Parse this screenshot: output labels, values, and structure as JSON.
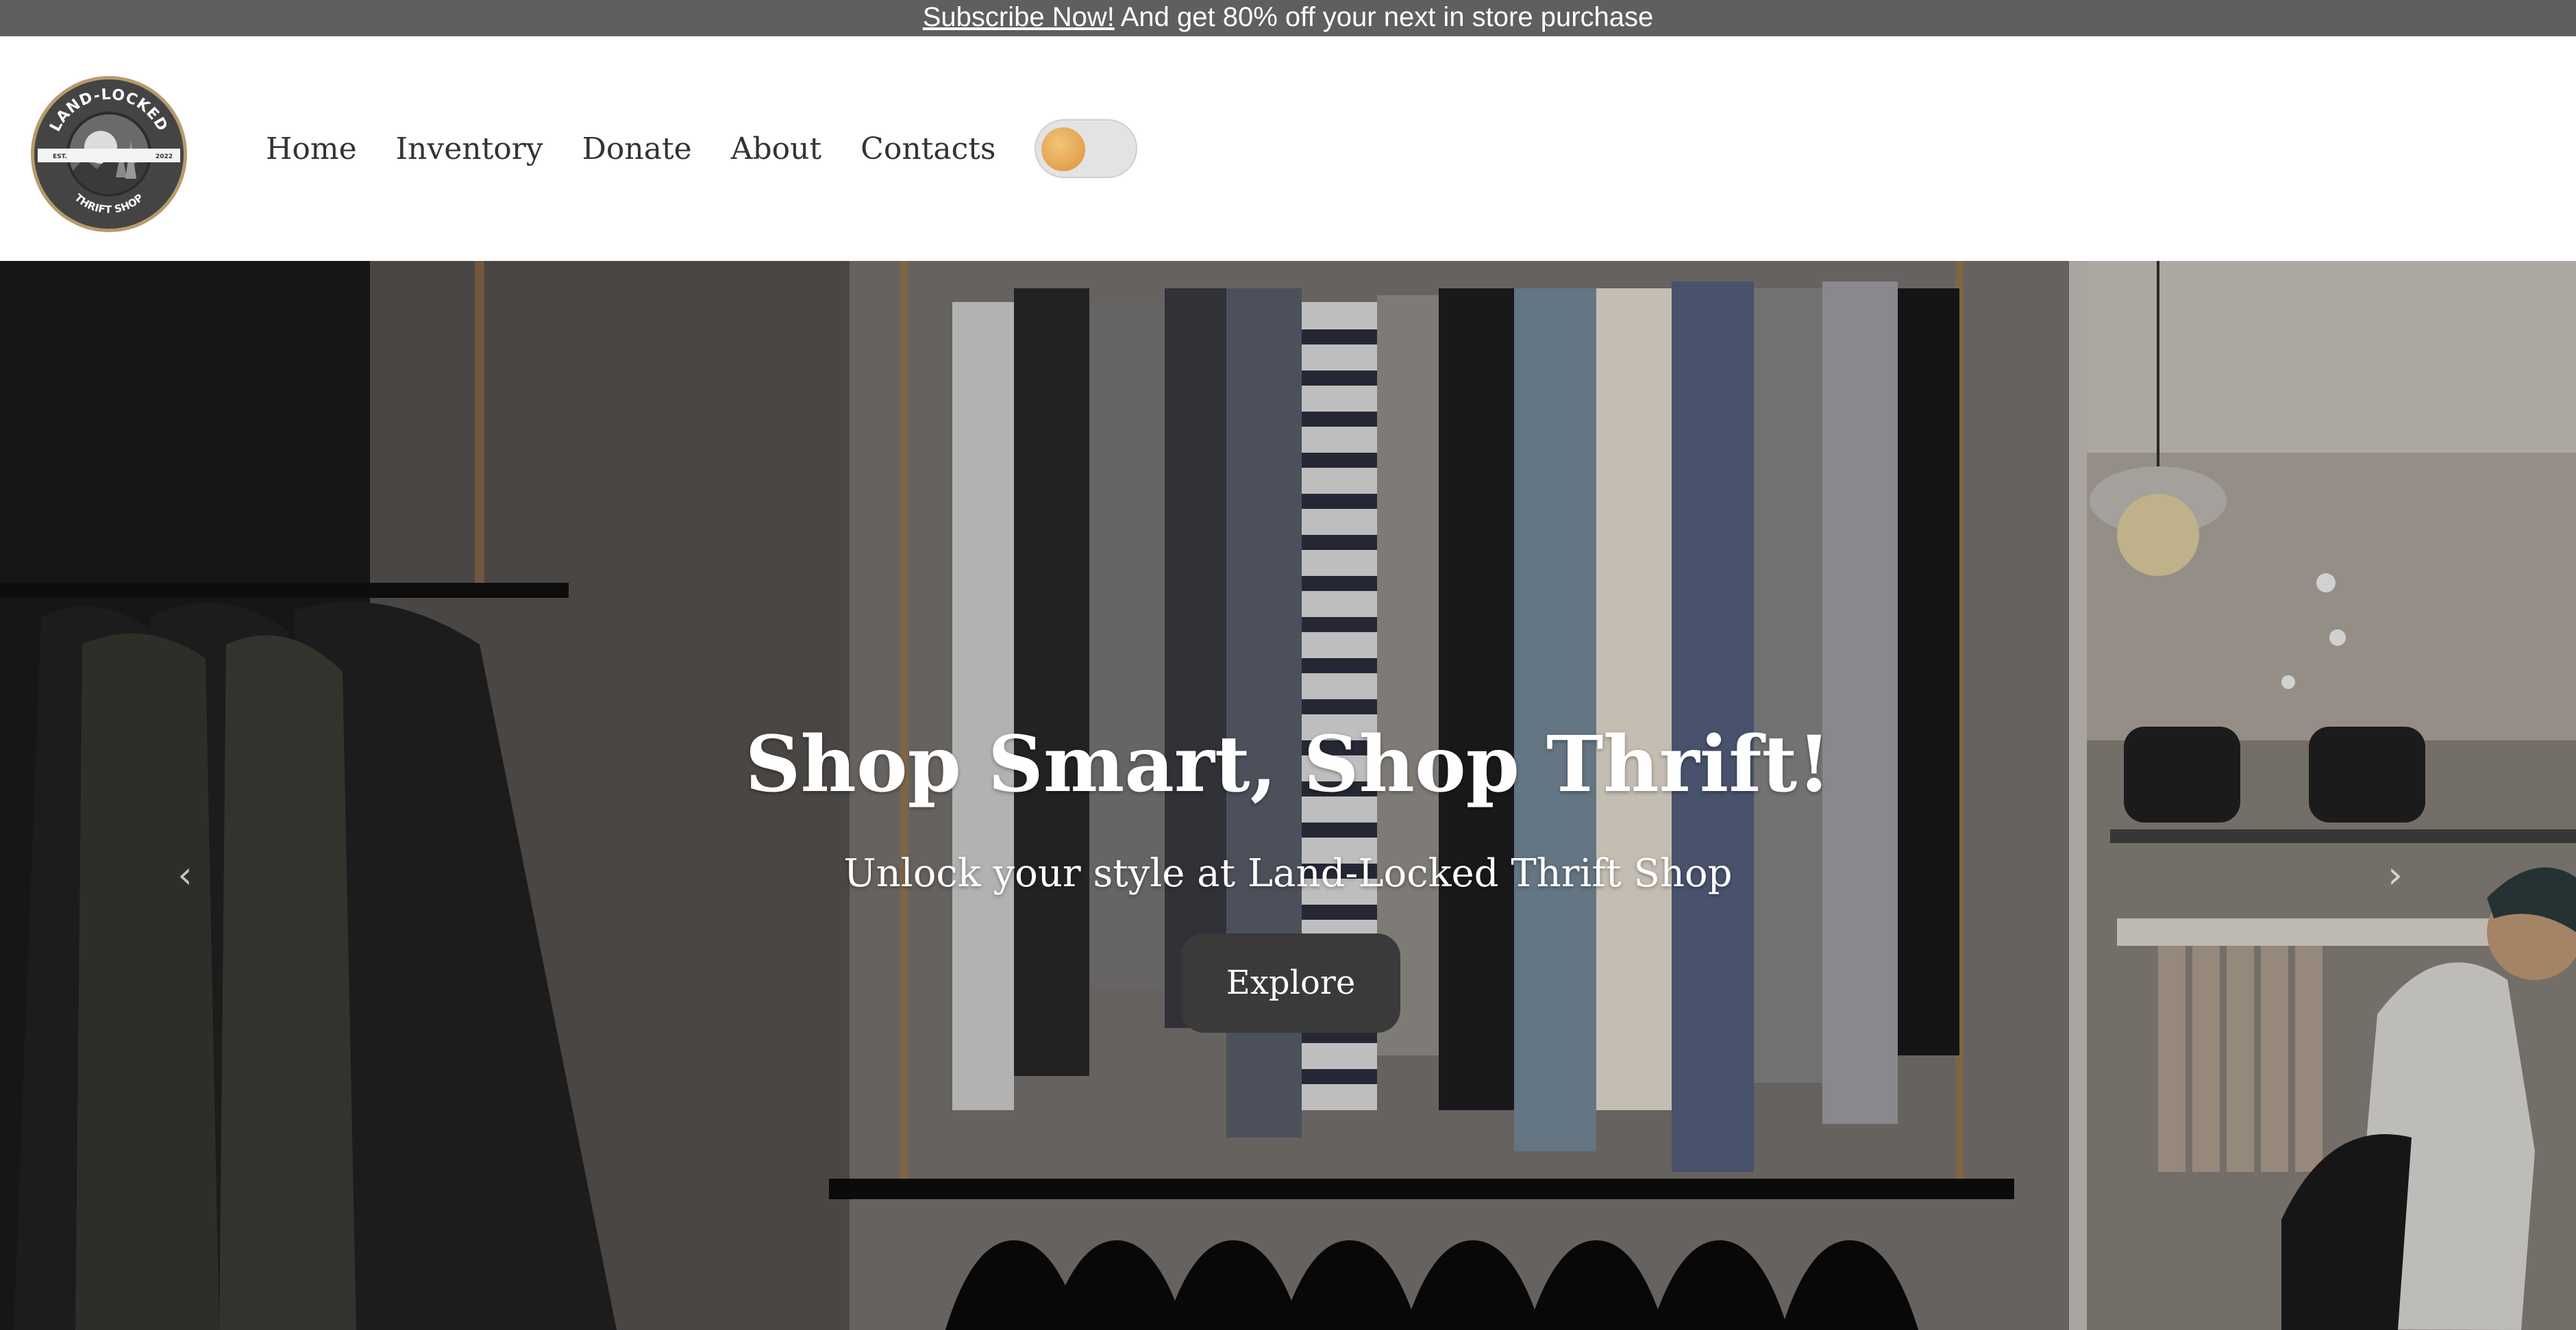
{
  "announcement": {
    "link_text": "Subscribe Now!",
    "message": " And get 80% off your next in store purchase"
  },
  "logo": {
    "alt": "Land-Locked Thrift Shop logo",
    "top_text": "LAND-LOCKED",
    "bottom_text": "THRIFT SHOP",
    "est_label": "EST.",
    "year": "2022"
  },
  "nav": {
    "items": [
      {
        "label": "Home"
      },
      {
        "label": "Inventory"
      },
      {
        "label": "Donate"
      },
      {
        "label": "About"
      },
      {
        "label": "Contacts"
      }
    ],
    "theme_toggle": {
      "state": "off"
    }
  },
  "hero": {
    "title": "Shop Smart, Shop Thrift!",
    "subtitle": "Unlock your style at Land-Locked Thrift Shop",
    "cta_label": "Explore",
    "prev_icon": "chevron-left-icon",
    "next_icon": "chevron-right-icon",
    "prev_glyph": "‹",
    "next_glyph": "›"
  },
  "colors": {
    "announcement_bg": "#5f5f5f",
    "nav_text": "#333333",
    "toggle_knob": "#e3a14e",
    "button_bg": "#3a3a3a"
  }
}
